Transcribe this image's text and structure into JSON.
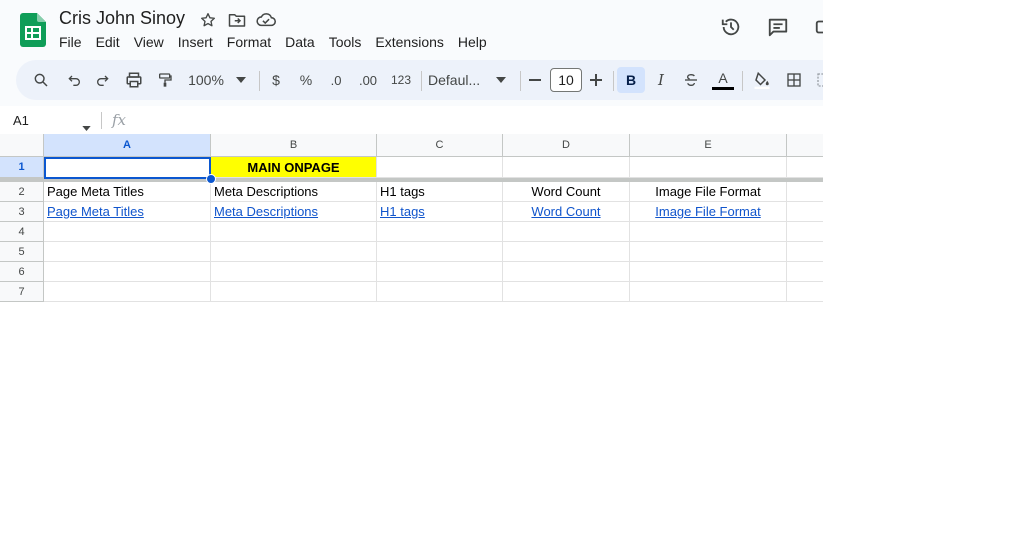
{
  "document": {
    "title": "Cris John Sinoy"
  },
  "menu": [
    "File",
    "Edit",
    "View",
    "Insert",
    "Format",
    "Data",
    "Tools",
    "Extensions",
    "Help"
  ],
  "toolbar": {
    "zoom": "100%",
    "currency": "$",
    "percent": "%",
    "decrease_decimal": ".0",
    "increase_decimal": ".00",
    "more_formats": "123",
    "font": "Defaul...",
    "font_size": "10",
    "bold": "B",
    "italic": "I",
    "text_color": "A"
  },
  "formula_bar": {
    "cell_ref": "A1",
    "fx": "fx"
  },
  "grid": {
    "columns": [
      "A",
      "B",
      "C",
      "D",
      "E"
    ],
    "rows": [
      "1",
      "2",
      "3",
      "4",
      "5",
      "6",
      "7"
    ],
    "row1": {
      "b": "MAIN ONPAGE"
    },
    "row2": [
      "Page Meta Titles",
      "Meta Descriptions",
      "H1 tags",
      "Word Count",
      "Image File Format"
    ],
    "row3": [
      "Page Meta Titles",
      "Meta Descriptions",
      "H1 tags",
      "Word Count",
      "Image File Format"
    ]
  },
  "colors": {
    "header_highlight": "#ffff00",
    "link": "#1155cc",
    "selection": "#0b57d0",
    "sheets_green": "#0f9d58"
  },
  "icons": [
    "sheets-logo",
    "star-icon",
    "move-folder-icon",
    "cloud-status-icon",
    "version-history-icon",
    "comment-icon",
    "search-icon",
    "undo-icon",
    "redo-icon",
    "print-icon",
    "paint-format-icon",
    "strikethrough-icon",
    "fill-color-icon",
    "borders-icon"
  ]
}
